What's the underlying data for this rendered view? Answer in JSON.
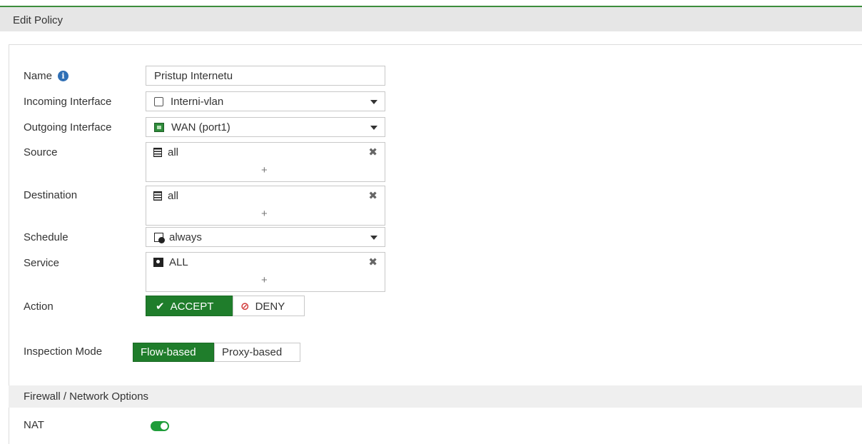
{
  "window": {
    "title": "Edit Policy"
  },
  "form": {
    "name": {
      "label": "Name",
      "value": "Pristup Internetu"
    },
    "incoming": {
      "label": "Incoming Interface",
      "value": "Interni-vlan"
    },
    "outgoing": {
      "label": "Outgoing Interface",
      "value": "WAN (port1)"
    },
    "source": {
      "label": "Source",
      "value": "all",
      "add": "+"
    },
    "destination": {
      "label": "Destination",
      "value": "all",
      "add": "+"
    },
    "schedule": {
      "label": "Schedule",
      "value": "always"
    },
    "service": {
      "label": "Service",
      "value": "ALL",
      "add": "+"
    },
    "action": {
      "label": "Action",
      "accept": "ACCEPT",
      "deny": "DENY",
      "selected": "ACCEPT"
    },
    "inspection": {
      "label": "Inspection Mode",
      "flow": "Flow-based",
      "proxy": "Proxy-based",
      "selected": "Flow-based"
    }
  },
  "firewall": {
    "header": "Firewall / Network Options",
    "nat": {
      "label": "NAT",
      "enabled": true
    }
  },
  "icons": {
    "info": "i",
    "check": "✔",
    "deny": "⊘",
    "remove": "✖"
  },
  "colors": {
    "accent": "#1f7d2b",
    "toggle": "#1f9d3a",
    "deny": "#d23b3b",
    "info": "#2f6fb5"
  }
}
